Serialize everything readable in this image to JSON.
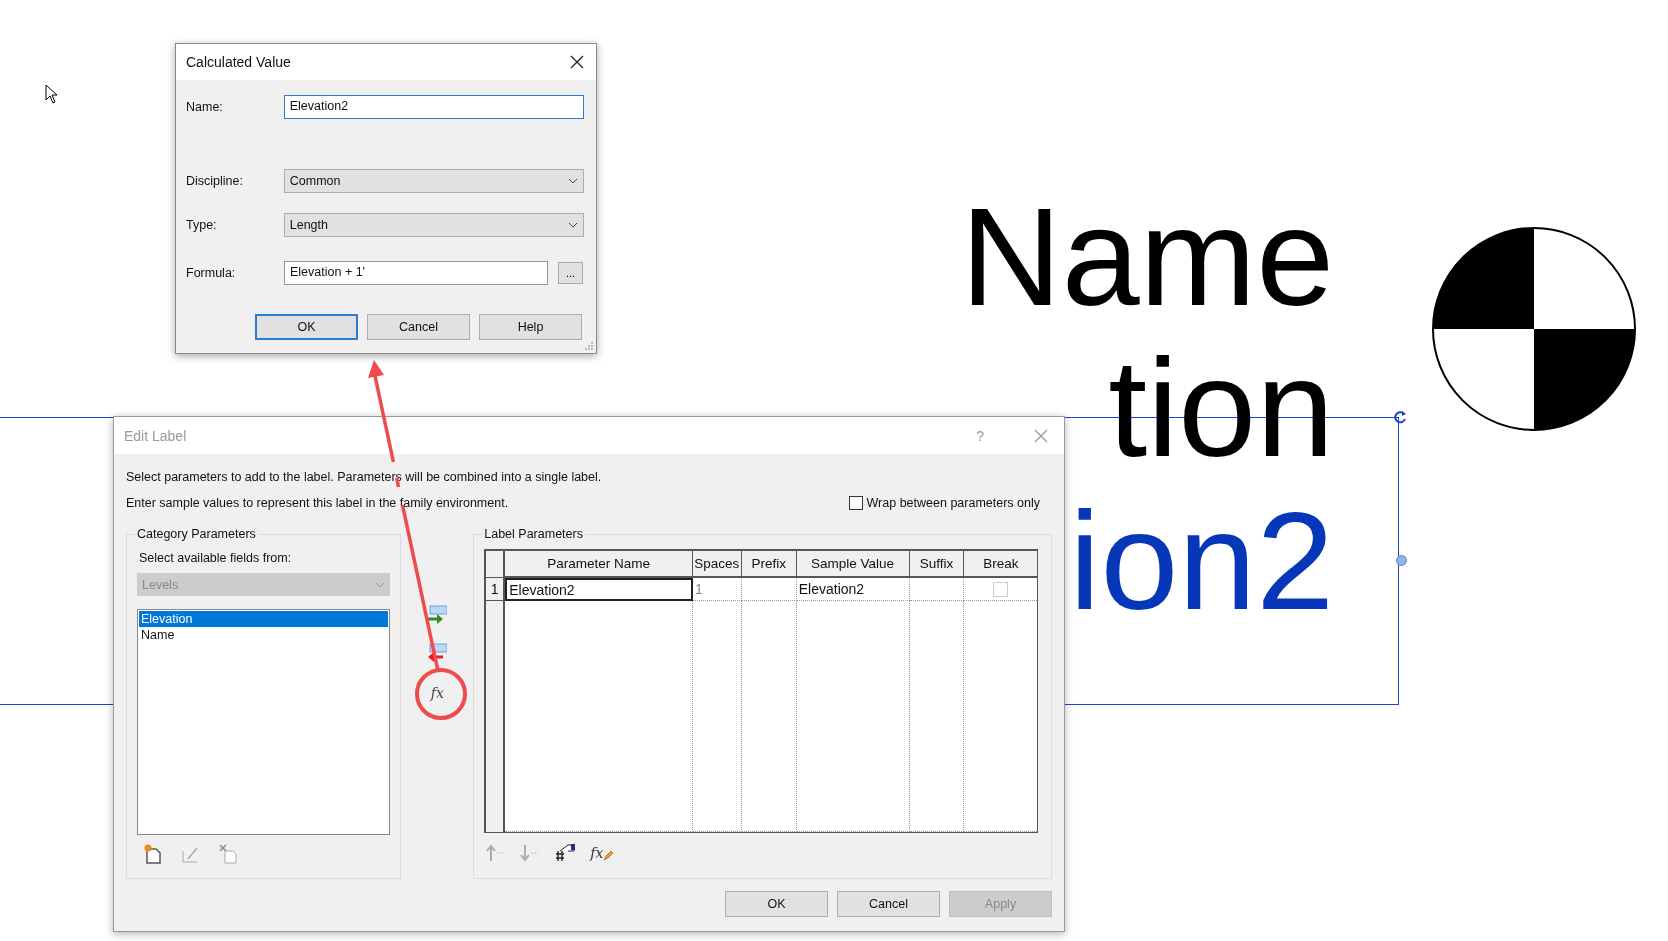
{
  "canvas": {
    "label_lines": [
      {
        "text": "Name",
        "selected": false
      },
      {
        "text": "tion",
        "selected": false
      },
      {
        "text": "ion2",
        "selected": true
      }
    ]
  },
  "calculated_value": {
    "title": "Calculated Value",
    "fields": [
      {
        "label": "Name:",
        "kind": "text",
        "value": "Elevation2",
        "focused": true
      },
      {
        "label": "Discipline:",
        "kind": "dropdown",
        "value": "Common"
      },
      {
        "label": "Type:",
        "kind": "dropdown",
        "value": "Length"
      },
      {
        "label": "Formula:",
        "kind": "text",
        "value": "Elevation + 1'",
        "focused": false,
        "browse": "..."
      }
    ],
    "buttons": [
      {
        "label": "OK",
        "default": true
      },
      {
        "label": "Cancel",
        "default": false
      },
      {
        "label": "Help",
        "default": false
      }
    ]
  },
  "edit_label": {
    "title": "Edit Label",
    "help": "?",
    "instructions": [
      "Select parameters to add to the label.  Parameters will be combined into a single label.",
      "Enter sample values to represent this label in the family environment."
    ],
    "wrap_option": {
      "label": "Wrap between parameters only",
      "checked": false
    },
    "category_parameters": {
      "title": "Category Parameters",
      "source_label": "Select available fields from:",
      "source": {
        "value": "Levels",
        "disabled": true
      },
      "fields": [
        {
          "label": "Elevation",
          "selected": true
        },
        {
          "label": "Name",
          "selected": false
        }
      ]
    },
    "formula_button": "fx",
    "label_parameters": {
      "title": "Label Parameters",
      "columns": [
        "Parameter Name",
        "Spaces",
        "Prefix",
        "Sample Value",
        "Suffix",
        "Break"
      ],
      "rows": [
        {
          "number": "1",
          "parameter_name": "Elevation2",
          "spaces": "1",
          "sample_value": "Elevation2",
          "break": false
        }
      ],
      "edit_formula_button": "fx"
    },
    "buttons": [
      {
        "label": "OK",
        "disabled": false
      },
      {
        "label": "Cancel",
        "disabled": false
      },
      {
        "label": "Apply",
        "disabled": true
      }
    ]
  }
}
